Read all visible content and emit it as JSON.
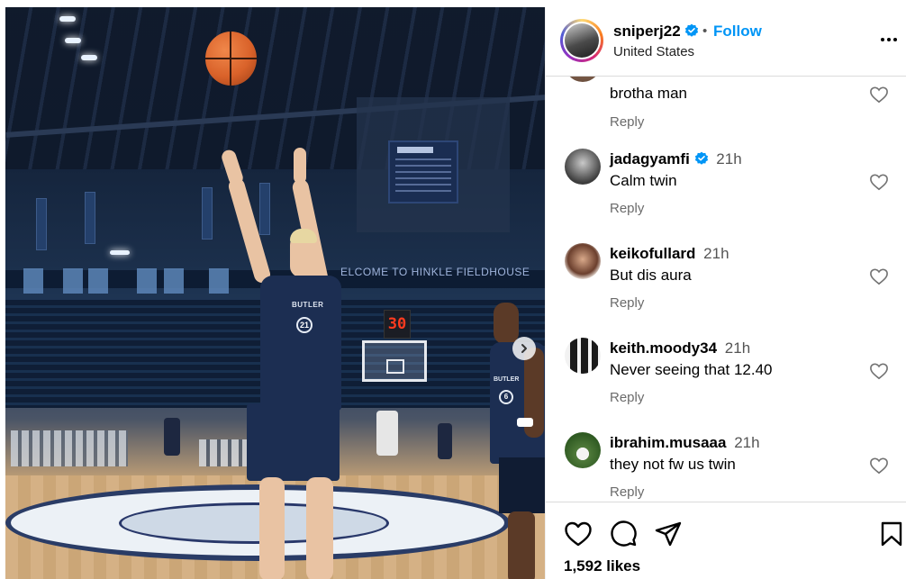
{
  "post": {
    "username": "sniperj22",
    "follow_label": "Follow",
    "separator": "•",
    "location": "United States",
    "likes": "1,592 likes"
  },
  "photo": {
    "shot_clock": "30",
    "arena_banner": "ELCOME TO HINKLE FIELDHOUSE",
    "jersey_word": "BUTLER",
    "jersey_number": "21",
    "player2_number": "6"
  },
  "comments": [
    {
      "username": "",
      "time": "",
      "text": "brotha man",
      "reply_label": "Reply"
    },
    {
      "username": "jadagyamfi",
      "verified": true,
      "time": "21h",
      "text": "Calm twin",
      "reply_label": "Reply"
    },
    {
      "username": "keikofullard",
      "time": "21h",
      "text": "But dis aura",
      "reply_label": "Reply"
    },
    {
      "username": "keith.moody34",
      "time": "21h",
      "text": "Never seeing that 12.40",
      "reply_label": "Reply"
    },
    {
      "username": "ibrahim.musaaa",
      "time": "21h",
      "text": "they not fw us twin",
      "reply_label": "Reply"
    }
  ],
  "icons": {
    "verified": "verified-badge-icon",
    "more": "more-options-icon",
    "heart": "heart-icon",
    "comment": "comment-icon",
    "share": "share-icon",
    "save": "bookmark-icon",
    "carousel": "chevron-right-icon"
  },
  "colors": {
    "accent": "#0095f6",
    "verified": "#0095f6",
    "secondary_text": "#6b6b6b",
    "divider": "#dbdbdb"
  }
}
